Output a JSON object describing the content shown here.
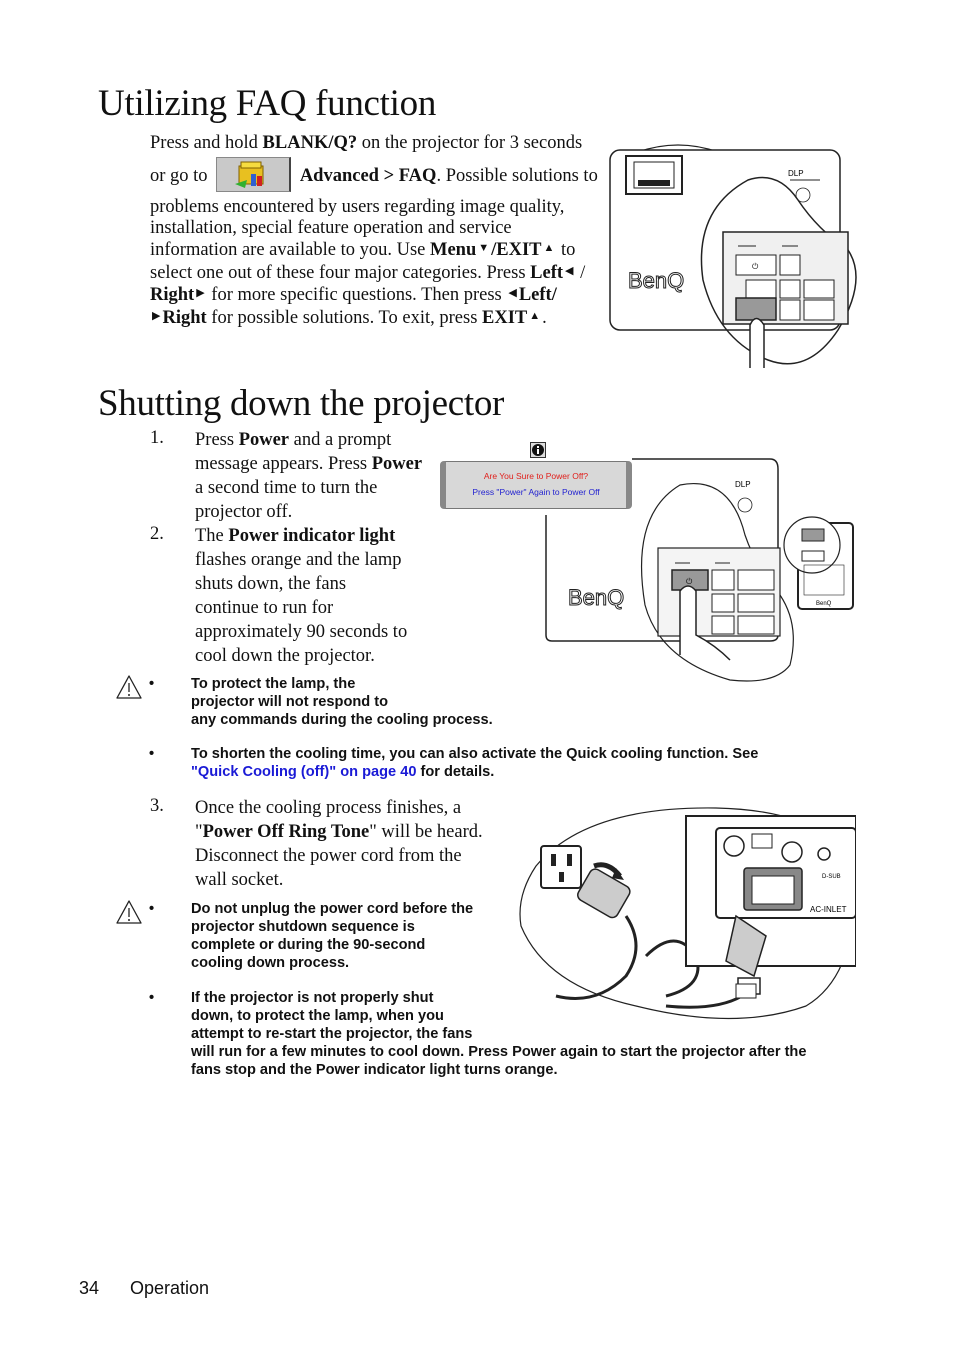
{
  "sections": {
    "faq": {
      "title": "Utilizing FAQ function",
      "para": {
        "p1a": "Press and hold ",
        "k_blank": "BLANK/Q?",
        "p1b": " on the projector for 3 seconds",
        "p2a": "or go to",
        "k_adv": "Advanced > FAQ",
        "p2b": ". Possible solutions to",
        "p3": "problems encountered by users regarding image quality,",
        "p4": "installation, special feature operation and service",
        "p5a": "information are available to you. Use ",
        "k_menu": "Menu",
        "k_exit": "/EXIT",
        "p5b": " to",
        "p6a": "select one out of these four major categories. Press ",
        "k_left": "Left",
        "p6b": " /",
        "k_right": "Right",
        "p7a": " for more specific questions. Then press ",
        "k_left2": "Left/",
        "k_right2": "Right",
        "p8a": " for possible solutions. To exit, press ",
        "k_exit2": "EXIT",
        "p8b": "."
      },
      "icon": "advanced-menu-icon",
      "illustration": "projector-top-panel-blank-button"
    },
    "shutdown": {
      "title": "Shutting down the projector",
      "steps": [
        {
          "num": "1.",
          "lines": [
            "Press ",
            "Power",
            " and a prompt",
            "message appears. Press ",
            "Power",
            "a second time to turn the",
            "projector off."
          ]
        },
        {
          "num": "2.",
          "lines": [
            "The ",
            "Power indicator light",
            "flashes orange and the lamp",
            "shuts down, the fans",
            "continue to run for",
            "approximately 90 seconds to",
            "cool down the projector."
          ]
        },
        {
          "num": "3.",
          "lines": [
            "Once the cooling process finishes, a",
            "\"",
            "Power Off Ring Tone",
            "\" will be heard.",
            "Disconnect the power cord from the",
            "wall socket."
          ]
        }
      ],
      "prompt": {
        "line1": "Are You Sure to Power Off?",
        "line2": "Press \"Power\" Again to Power Off"
      },
      "notes1": [
        {
          "lines": [
            "To protect the lamp, the",
            "projector will not respond to",
            "any commands during the cooling process."
          ]
        },
        {
          "text": "To shorten the cooling time, you can also activate the Quick cooling function. See",
          "link": "\"Quick Cooling (off)\" on page 40",
          "after": " for details."
        }
      ],
      "notes2": [
        {
          "lines": [
            "Do not unplug the power cord before the",
            "projector shutdown sequence is",
            "complete or during the 90-second",
            "cooling down process."
          ]
        },
        {
          "lines": [
            "If the projector is not properly shut",
            "down, to protect the lamp, when you",
            "attempt to re-start the projector, the fans",
            "will run for a few minutes to cool down. Press Power again to start the projector after the",
            "fans stop and the Power indicator light turns orange."
          ]
        }
      ],
      "bullet": "•",
      "ac_inlet_label": "AC-INLET",
      "dsub_label": "D-SUB",
      "brand": "BenQ"
    }
  },
  "footer": {
    "page_number": "34",
    "section": "Operation"
  },
  "colors": {
    "link": "#1a1ad6",
    "prompt_warning": "#e0201c",
    "prompt_info": "#2222d0"
  }
}
